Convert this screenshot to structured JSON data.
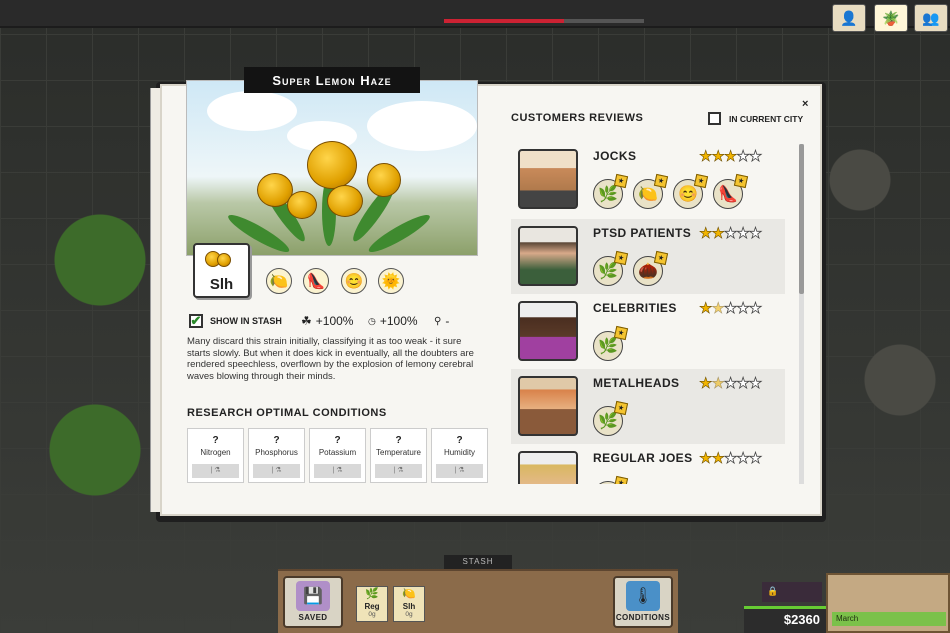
{
  "strain": {
    "title": "Super Lemon Haze",
    "abbr": "Slh",
    "effects": [
      "lemon-icon",
      "high-heel-icon",
      "smiley-icon",
      "sun-face-icon"
    ],
    "show_in_stash_label": "SHOW IN STASH",
    "show_in_stash_checked": "✔",
    "stat1": "+100%",
    "stat2": "+100%",
    "stat3": "-",
    "description": "Many discard this strain initially, classifying it as too weak - it sure starts slowly. But when it does kick in eventually, all the doubters are rendered speechless, overflown by the explosion of lemony cerebral waves blowing through their minds."
  },
  "research": {
    "heading": "RESEARCH OPTIMAL CONDITIONS",
    "conditions": [
      {
        "q": "?",
        "name": "Nitrogen",
        "slot": "| ⚗"
      },
      {
        "q": "?",
        "name": "Phosphorus",
        "slot": "| ⚗"
      },
      {
        "q": "?",
        "name": "Potassium",
        "slot": "| ⚗"
      },
      {
        "q": "?",
        "name": "Temperature",
        "slot": "| ⚗"
      },
      {
        "q": "?",
        "name": "Humidity",
        "slot": "| ⚗"
      }
    ]
  },
  "reviews": {
    "heading": "CUSTOMERS REVIEWS",
    "city_filter_label": "IN CURRENT CITY",
    "close": "×",
    "groups": [
      {
        "name": "JOCKS",
        "rating": 3,
        "prefs": [
          "cannabis-leaf-icon",
          "lemon-icon",
          "smiley-icon",
          "high-heel-icon"
        ]
      },
      {
        "name": "PTSD PATIENTS",
        "rating": 2,
        "prefs": [
          "cannabis-leaf-icon",
          "walnut-icon"
        ]
      },
      {
        "name": "CELEBRITIES",
        "rating": 1.5,
        "prefs": [
          "cannabis-leaf-icon"
        ]
      },
      {
        "name": "METALHEADS",
        "rating": 1.5,
        "prefs": [
          "cannabis-leaf-icon"
        ]
      },
      {
        "name": "REGULAR JOES",
        "rating": 2,
        "prefs": [
          "cannabis-leaf-icon"
        ]
      }
    ]
  },
  "bottom": {
    "stash_tab": "STASH",
    "saved_label": "SAVED",
    "conditions_label": "CONDITIONS",
    "stash_items": [
      {
        "label": "Reg",
        "amount": "0g"
      },
      {
        "label": "Slh",
        "amount": "0g"
      }
    ]
  },
  "status": {
    "money": "$2360",
    "month": "March"
  },
  "colors": {
    "accent": "#f1b400",
    "panel": "#f7f6f2",
    "money_green": "#66cc33"
  }
}
